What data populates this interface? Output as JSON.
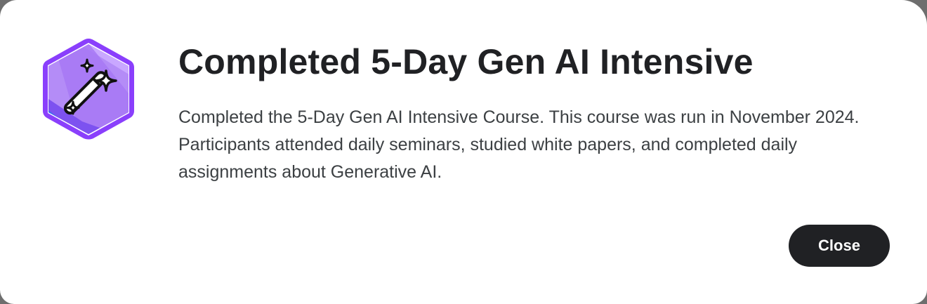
{
  "dialog": {
    "badge_icon": "magic-wand-sparkles-icon",
    "title": "Completed 5-Day Gen AI Intensive",
    "description": "Completed the 5-Day Gen AI Intensive Course. This course was run in November 2024. Participants attended daily seminars, studied white papers, and completed daily assignments about Generative AI.",
    "close_label": "Close"
  },
  "colors": {
    "badge_border": "#8a3ffc",
    "badge_fill_light": "#c9a7ff",
    "badge_fill_mid": "#a778f5",
    "badge_fill_blue": "#3b6cf0",
    "button_bg": "#202124",
    "title_text": "#202124"
  }
}
